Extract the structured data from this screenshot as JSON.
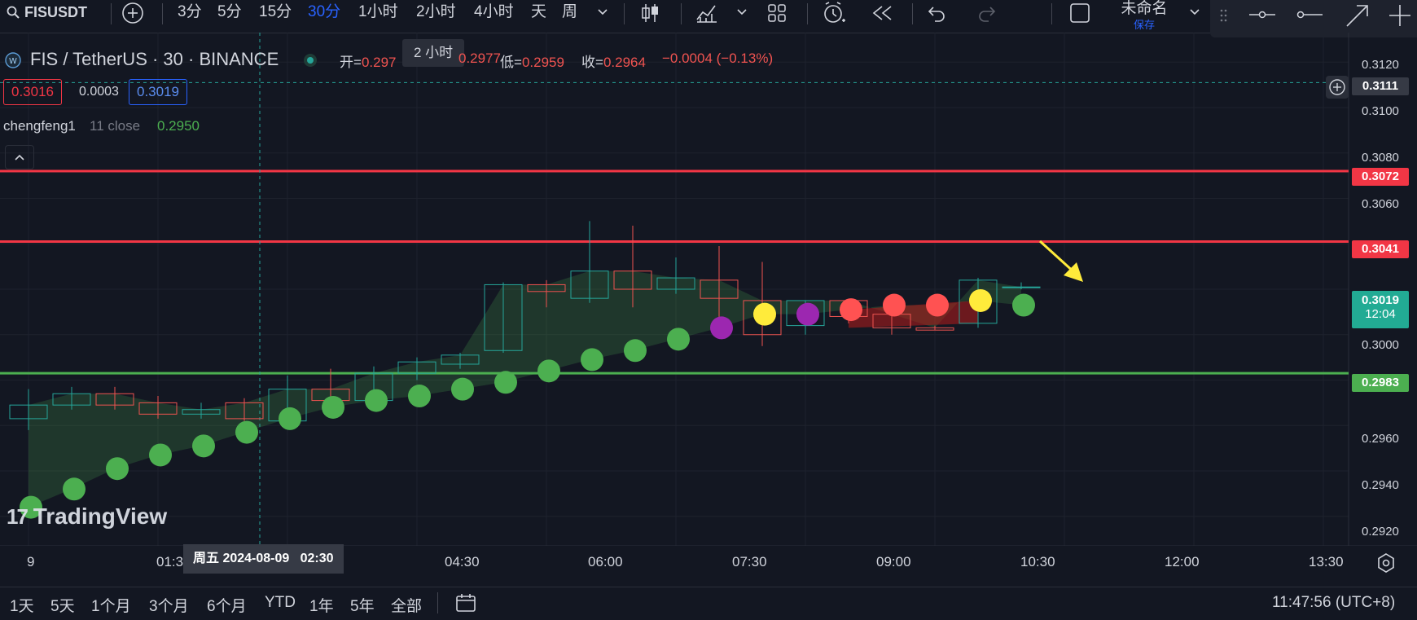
{
  "toolbar": {
    "symbol": "FISUSDT",
    "intervals": [
      "3分",
      "5分",
      "15分",
      "30分",
      "1小时",
      "2小时",
      "4小时",
      "天",
      "周"
    ],
    "active_interval": "30分",
    "layout_name": "未命名",
    "layout_save": "保存",
    "tooltip": "2 小时"
  },
  "legend": {
    "title": "FIS / TetherUS · 30 · BINANCE",
    "open_label": "开=",
    "open_value": "0.297",
    "high_value": "0.2977",
    "low_label": "低=",
    "low_value": "0.2959",
    "close_label": "收=",
    "close_value": "0.2964",
    "change": "−0.0004 (−0.13%)",
    "bid": "0.3016",
    "spread": "0.0003",
    "ask": "0.3019",
    "indicator_name": "chengfeng1",
    "indicator_params": "11 close",
    "indicator_value": "0.2950"
  },
  "price_axis": {
    "ticks": [
      "0.3120",
      "0.3100",
      "0.3080",
      "0.3060",
      "0.3000",
      "0.2960",
      "0.2940",
      "0.2920"
    ],
    "labels": [
      {
        "text": "0.3111",
        "kind": "crosshair"
      },
      {
        "text": "0.3072",
        "kind": "red"
      },
      {
        "text": "0.3041",
        "kind": "red"
      },
      {
        "text": "0.3019",
        "kind": "current",
        "sub": "12:04"
      },
      {
        "text": "0.2983",
        "kind": "green"
      }
    ]
  },
  "time_axis": {
    "ticks": [
      "9",
      "01:3",
      "04:30",
      "06:00",
      "07:30",
      "09:00",
      "10:30",
      "12:00",
      "13:30"
    ],
    "crosshair_label": "周五 2024-08-09   02:30"
  },
  "watermark": "TradingView",
  "bottombar": {
    "ranges": [
      "1天",
      "5天",
      "1个月",
      "3个月",
      "6个月",
      "YTD",
      "1年",
      "5年",
      "全部"
    ],
    "clock": "11:47:56 (UTC+8)"
  },
  "colors": {
    "bg": "#131722",
    "up": "#26a69a",
    "down": "#ef5350",
    "red_line": "#f23645",
    "green_line": "#4caf50",
    "dot_green": "#4caf50",
    "dot_yellow": "#ffeb3b",
    "dot_purple": "#9c27b0",
    "dot_red": "#ff5252",
    "accent": "#2962ff"
  },
  "chart_data": {
    "type": "candlestick",
    "x": [
      "00:00",
      "00:30",
      "01:00",
      "01:30",
      "02:00",
      "02:30",
      "03:00",
      "03:30",
      "04:00",
      "04:30",
      "05:00",
      "05:30",
      "06:00",
      "06:30",
      "07:00",
      "07:30",
      "08:00",
      "08:30",
      "09:00",
      "09:30",
      "10:00",
      "10:30",
      "11:00",
      "11:30"
    ],
    "series": [
      {
        "ohlc": [
          [
            0.2963,
            0.2976,
            0.2958,
            0.2969
          ],
          [
            0.2969,
            0.2977,
            0.2967,
            0.2974
          ],
          [
            0.2974,
            0.2977,
            0.2967,
            0.2969
          ],
          [
            0.297,
            0.2973,
            0.2963,
            0.2965
          ],
          [
            0.2965,
            0.297,
            0.2963,
            0.2967
          ],
          [
            0.297,
            0.2972,
            0.2962,
            0.2963
          ],
          [
            0.2962,
            0.2982,
            0.296,
            0.2976
          ],
          [
            0.2976,
            0.2985,
            0.297,
            0.2971
          ],
          [
            0.2971,
            0.2986,
            0.297,
            0.2983
          ],
          [
            0.2983,
            0.299,
            0.298,
            0.2988
          ],
          [
            0.2987,
            0.2992,
            0.2985,
            0.2991
          ],
          [
            0.2993,
            0.3023,
            0.2992,
            0.3022
          ],
          [
            0.3022,
            0.3024,
            0.3012,
            0.3019
          ],
          [
            0.3016,
            0.305,
            0.3014,
            0.3028
          ],
          [
            0.3028,
            0.3048,
            0.3012,
            0.302
          ],
          [
            0.302,
            0.3034,
            0.3018,
            0.3025
          ],
          [
            0.3024,
            0.3039,
            0.3006,
            0.3016
          ],
          [
            0.3015,
            0.3032,
            0.2995,
            0.3
          ],
          [
            0.3004,
            0.3015,
            0.3,
            0.3015
          ],
          [
            0.3015,
            0.3015,
            0.3005,
            0.3008
          ],
          [
            0.3009,
            0.3009,
            0.3,
            0.3003
          ],
          [
            0.3003,
            0.3004,
            0.3002,
            0.3002
          ],
          [
            0.3005,
            0.3025,
            0.3003,
            0.3024
          ],
          [
            0.3021,
            0.3023,
            0.302,
            0.3021
          ]
        ]
      },
      {
        "type": "dots",
        "values": [
          0.2924,
          0.2932,
          0.2941,
          0.2947,
          0.2951,
          0.2957,
          0.2963,
          0.2968,
          0.2971,
          0.2973,
          0.2976,
          0.2979,
          0.2984,
          0.2989,
          0.2993,
          0.2998,
          0.3003,
          0.3009,
          0.3009,
          0.3011,
          0.3013,
          0.3013,
          0.3015,
          0.3013
        ],
        "colors": [
          "green",
          "green",
          "green",
          "green",
          "green",
          "green",
          "green",
          "green",
          "green",
          "green",
          "green",
          "green",
          "green",
          "green",
          "green",
          "green",
          "purple",
          "yellow",
          "purple",
          "red",
          "red",
          "red",
          "yellow",
          "green"
        ]
      }
    ],
    "hlines": [
      {
        "value": 0.3072,
        "color": "red"
      },
      {
        "value": 0.3041,
        "color": "red"
      },
      {
        "value": 0.2983,
        "color": "green"
      }
    ],
    "ylim": [
      0.2907,
      0.3133
    ],
    "grid": true
  }
}
